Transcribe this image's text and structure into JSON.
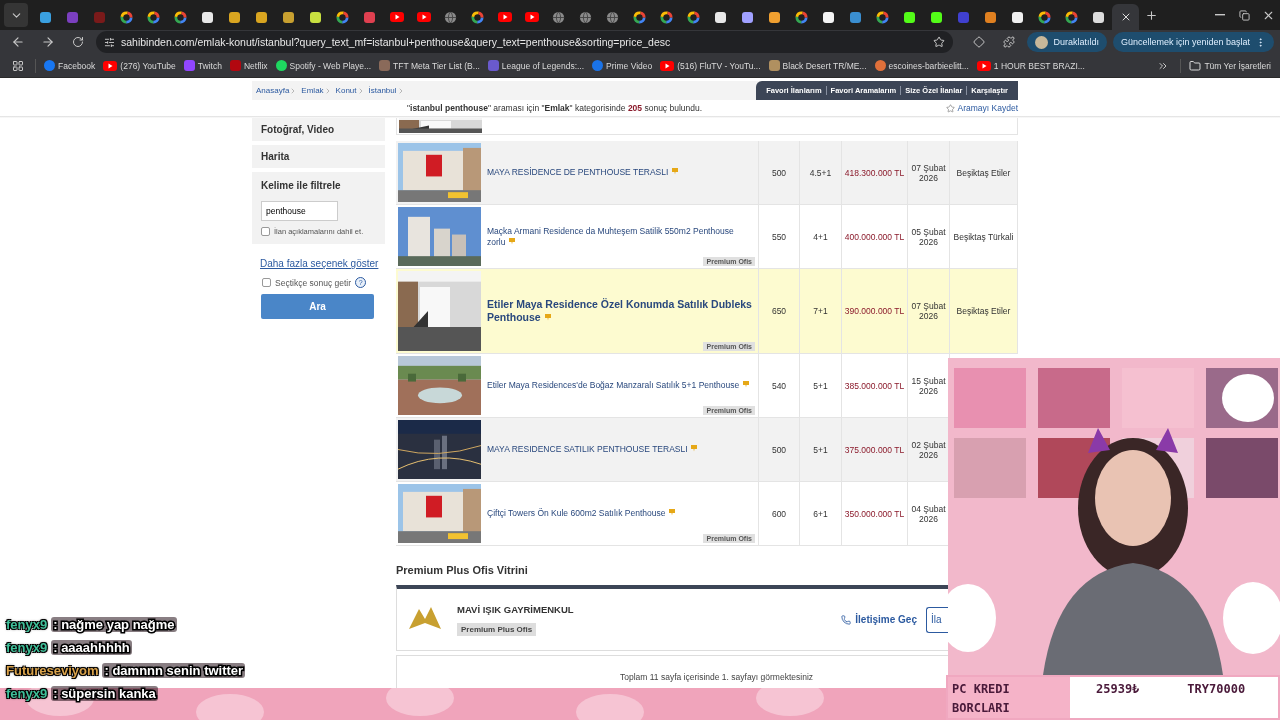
{
  "browser": {
    "tabs": [
      {
        "kind": "square",
        "color": "#3aa0e0",
        "selected": false
      },
      {
        "kind": "square",
        "color": "#7b3fbf",
        "selected": false
      },
      {
        "kind": "square",
        "color": "#7a1a1a",
        "selected": false
      },
      {
        "kind": "google",
        "selected": false
      },
      {
        "kind": "google",
        "selected": false
      },
      {
        "kind": "google",
        "selected": false
      },
      {
        "kind": "square",
        "color": "#e8e8e8",
        "selected": false
      },
      {
        "kind": "square",
        "color": "#d9a520",
        "selected": false
      },
      {
        "kind": "square",
        "color": "#d9a520",
        "selected": false
      },
      {
        "kind": "square",
        "color": "#c8a030",
        "selected": false
      },
      {
        "kind": "square",
        "color": "#c8e040",
        "selected": false
      },
      {
        "kind": "google",
        "selected": false
      },
      {
        "kind": "square",
        "color": "#e04050",
        "selected": false
      },
      {
        "kind": "youtube",
        "selected": false
      },
      {
        "kind": "youtube",
        "selected": false
      },
      {
        "kind": "globe",
        "selected": false
      },
      {
        "kind": "google",
        "selected": false
      },
      {
        "kind": "youtube",
        "selected": false
      },
      {
        "kind": "youtube",
        "selected": false
      },
      {
        "kind": "globe",
        "selected": false
      },
      {
        "kind": "globe",
        "selected": false
      },
      {
        "kind": "globe",
        "selected": false
      },
      {
        "kind": "google",
        "selected": false
      },
      {
        "kind": "google",
        "selected": false
      },
      {
        "kind": "google",
        "selected": false
      },
      {
        "kind": "square",
        "color": "#e8e8e8",
        "selected": false
      },
      {
        "kind": "square",
        "color": "#a0a0ff",
        "selected": false
      },
      {
        "kind": "square",
        "color": "#f0a030",
        "selected": false
      },
      {
        "kind": "google",
        "selected": false
      },
      {
        "kind": "square",
        "color": "#f4f4f4",
        "selected": false
      },
      {
        "kind": "square",
        "color": "#3a8ed0",
        "selected": false
      },
      {
        "kind": "google",
        "selected": false
      },
      {
        "kind": "square",
        "color": "#53fc18",
        "selected": false
      },
      {
        "kind": "square",
        "color": "#53fc18",
        "selected": false
      },
      {
        "kind": "square",
        "color": "#4040d0",
        "selected": false
      },
      {
        "kind": "square",
        "color": "#e08020",
        "selected": false
      },
      {
        "kind": "square",
        "color": "#f0f0f0",
        "selected": false
      },
      {
        "kind": "google",
        "selected": false
      },
      {
        "kind": "google",
        "selected": false
      },
      {
        "kind": "square",
        "color": "#dcdcdc",
        "selected": false
      },
      {
        "kind": "blank",
        "selected": true
      }
    ],
    "url": "sahibinden.com/emlak-konut/istanbul?query_text_mf=istanbul+penthouse&query_text=penthouse&sorting=price_desc",
    "profile": "Duraklatıldı",
    "update_button": "Güncellemek için yeniden başlat",
    "bookmarks": [
      {
        "kind": "circle",
        "color": "#1877f2",
        "label": "Facebook"
      },
      {
        "kind": "youtube",
        "label": "(276) YouTube"
      },
      {
        "kind": "square",
        "color": "#9146ff",
        "label": "Twitch"
      },
      {
        "kind": "square",
        "color": "#b20710",
        "label": "Netflix"
      },
      {
        "kind": "circle",
        "color": "#1ed760",
        "label": "Spotify - Web Playe..."
      },
      {
        "kind": "square",
        "color": "#8a6a5a",
        "label": "TFT Meta Tier List (B..."
      },
      {
        "kind": "square",
        "color": "#6a5acd",
        "label": "League of Legends:..."
      },
      {
        "kind": "circle",
        "color": "#1a73e8",
        "label": "Prime Video"
      },
      {
        "kind": "youtube",
        "label": "(516) FluTV - YouTu..."
      },
      {
        "kind": "square",
        "color": "#b09060",
        "label": "Black Desert TR/ME..."
      },
      {
        "kind": "circle",
        "color": "#e0703a",
        "label": "escoines-barbieelitt..."
      },
      {
        "kind": "youtube",
        "label": "1 HOUR BEST BRAZI..."
      }
    ],
    "all_bookmarks": "Tüm Yer İşaretleri"
  },
  "page": {
    "breadcrumbs": [
      "Anasayfa",
      "Emlak",
      "Konut",
      "İstanbul"
    ],
    "top_links": [
      "Favori İlanlarım",
      "Favori Aramalarım",
      "Size Özel İlanlar",
      "Karşılaştır"
    ],
    "result_summary": "\"**istanbul penthouse**\" araması için \"**Emlak**\" kategorisinde **205** sonuç bulundu.",
    "save_search": "Aramayı Kaydet",
    "sidebar": {
      "sections": [
        "Fotoğraf, Video",
        "Harita"
      ],
      "keyword_title": "Kelime ile filtrele",
      "keyword_value": "penthouse",
      "include_desc": {
        "label": "İlan açıklamalarını dahil et.",
        "checked": false
      },
      "more_options": "Daha fazla seçenek göster",
      "instant": {
        "label": "Seçtikçe sonuç getir",
        "checked": false
      },
      "help": "?",
      "search_button": "Ara"
    },
    "listings": [
      {
        "title": "MAYA RESİDENCE DE PENTHOUSE TERASLI",
        "size": "500",
        "rooms": "4.5+1",
        "price": "418.300.000 TL",
        "date": "07 Şubat 2026",
        "location": "Beşiktaş Etiler",
        "highlighted": false
      },
      {
        "title": "Maçka Armani Residence da Muhteşem Satilik 550m2 Penthouse zorlu",
        "size": "550",
        "rooms": "4+1",
        "price": "400.000.000 TL",
        "date": "05 Şubat 2026",
        "location": "Beşiktaş Türkali",
        "badge": "Premium Ofis",
        "highlighted": false
      },
      {
        "title": "Etiler Maya Residence Özel Konumda Satılık Dubleks Penthouse",
        "size": "650",
        "rooms": "7+1",
        "price": "390.000.000 TL",
        "date": "07 Şubat 2026",
        "location": "Beşiktaş Etiler",
        "badge": "Premium Ofis",
        "highlighted": true
      },
      {
        "title": "Etiler Maya Residences'de Boğaz Manzaralı Satılık 5+1 Penthouse",
        "size": "540",
        "rooms": "5+1",
        "price": "385.000.000 TL",
        "date": "15 Şubat 2026",
        "badge": "Premium Ofis",
        "highlighted": false
      },
      {
        "title": "MAYA RESIDENCE SATILIK PENTHOUSE TERASLI",
        "size": "500",
        "rooms": "5+1",
        "price": "375.000.000 TL",
        "date": "02 Şubat 2026",
        "highlighted": false
      },
      {
        "title": "Çiftçi Towers Ön Kule 600m2 Satılık Penthouse",
        "size": "600",
        "rooms": "6+1",
        "price": "350.000.000 TL",
        "date": "04 Şubat 2026",
        "badge": "Premium Ofis",
        "highlighted": false
      }
    ],
    "showcase": {
      "title": "Premium Plus Ofis Vitrini",
      "office": "MAVİ IŞIK GAYRİMENKUL",
      "badge": "Premium Plus Ofis",
      "contact": "İletişime Geç",
      "button": "İla"
    },
    "pager": "Toplam 11 sayfa içerisinde 1. sayfayı görmektesiniz"
  },
  "stream": {
    "chat": [
      {
        "user": "fenyx9",
        "color": "#3fc09a",
        "message": ": nağme yap nağme"
      },
      {
        "user": "fenyx9",
        "color": "#3fc09a",
        "message": ": aaaahhhhh"
      },
      {
        "user": "Futureseviyom",
        "color": "#d9a24a",
        "message": ": damnnn senin twitter"
      },
      {
        "user": "fenyx9",
        "color": "#3fc09a",
        "message": ": süpersin kanka"
      }
    ],
    "goal": {
      "label": "PC KREDI BORCLARI",
      "current": "25939₺",
      "target": "TRY70000"
    }
  }
}
